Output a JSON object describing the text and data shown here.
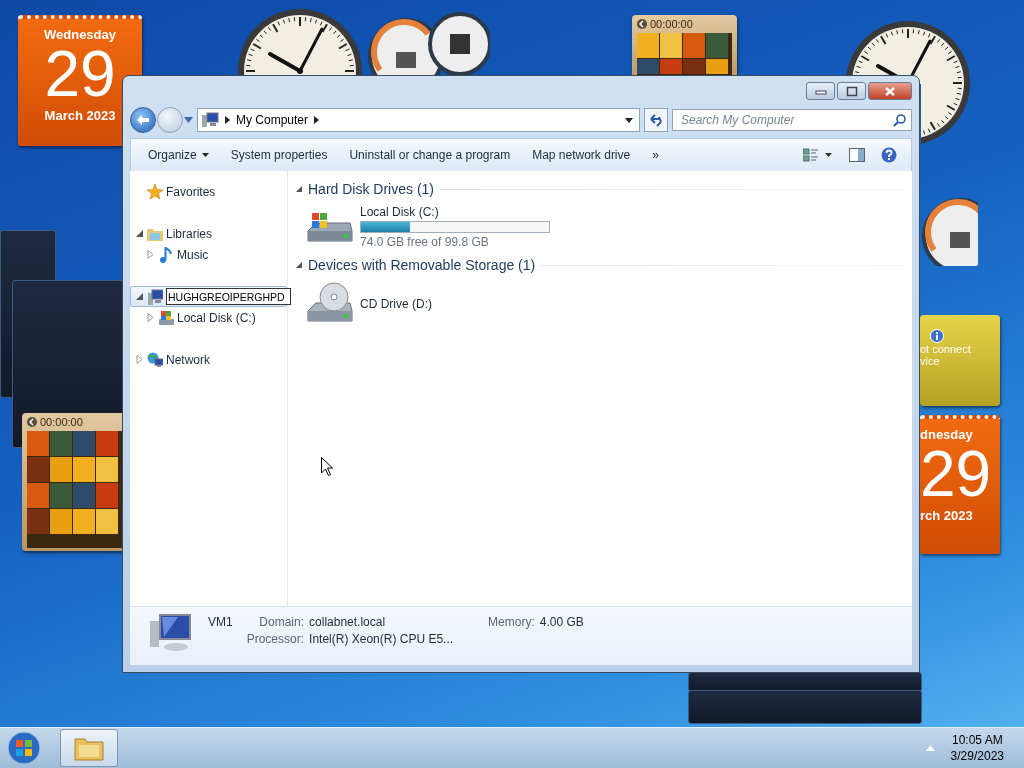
{
  "desktop": {
    "gadgets": [
      {
        "kind": "calendar",
        "weekday": "Wednesday",
        "day": "29",
        "month": "March 2023"
      },
      {
        "kind": "clock"
      },
      {
        "kind": "meter"
      },
      {
        "kind": "puzzle",
        "timer": "00:00:00"
      },
      {
        "kind": "clock"
      },
      {
        "kind": "panel"
      },
      {
        "kind": "panel"
      },
      {
        "kind": "meter"
      },
      {
        "kind": "weather",
        "lines": [
          "ot connect",
          "vice"
        ]
      },
      {
        "kind": "puzzle",
        "timer": "00:00:00"
      },
      {
        "kind": "calendar",
        "weekday": "dnesday",
        "day": "29",
        "month": "rch 2023"
      },
      {
        "kind": "panel"
      },
      {
        "kind": "panel"
      }
    ]
  },
  "window": {
    "address": {
      "crumbs": [
        "My Computer"
      ]
    },
    "search": {
      "placeholder": "Search My Computer"
    },
    "toolbar": {
      "commands": [
        {
          "label": "Organize",
          "dropdown": true
        },
        {
          "label": "System properties",
          "dropdown": false
        },
        {
          "label": "Uninstall or change a program",
          "dropdown": false
        },
        {
          "label": "Map network drive",
          "dropdown": false
        }
      ],
      "overflow": "»"
    },
    "navigation": [
      {
        "kind": "favorites",
        "label": "Favorites",
        "selected": false
      },
      {
        "kind": "libraries",
        "label": "Libraries",
        "selected": false,
        "expanded": true,
        "children": [
          {
            "kind": "music",
            "label": "Music",
            "selected": false,
            "expanded": false
          }
        ]
      },
      {
        "kind": "computer",
        "label": "HUGHGREOIPERGHPD",
        "renaming": true,
        "selected": true,
        "expanded": true,
        "children": [
          {
            "kind": "disk",
            "label": "Local Disk (C:)",
            "selected": false,
            "renaming": false,
            "expanded": false
          }
        ]
      },
      {
        "kind": "network",
        "label": "Network",
        "selected": false,
        "expanded": false
      }
    ],
    "groups": [
      {
        "title": "Hard Disk Drives (1)",
        "expanded": true,
        "items": [
          {
            "kind": "disk",
            "name": "Local Disk (C:)",
            "level": 0.26,
            "space": "74.0 GB free of 99.8 GB"
          }
        ]
      },
      {
        "title": "Devices with Removable Storage (1)",
        "expanded": true,
        "items": [
          {
            "kind": "cd",
            "name": "CD Drive (D:)"
          }
        ]
      }
    ],
    "details": {
      "name": "VM1",
      "fields": [
        {
          "label": "Domain:",
          "value": "collabnet.local"
        },
        {
          "label": "Memory:",
          "value": "4.00 GB"
        },
        {
          "label": "Processor:",
          "value": "Intel(R) Xeon(R) CPU E5..."
        }
      ]
    }
  },
  "taskbar": {
    "buttons": [
      {
        "kind": "start"
      },
      {
        "kind": "explorer",
        "active": true
      }
    ],
    "tray": {
      "time": "10:05 AM",
      "date": "3/29/2023"
    }
  }
}
